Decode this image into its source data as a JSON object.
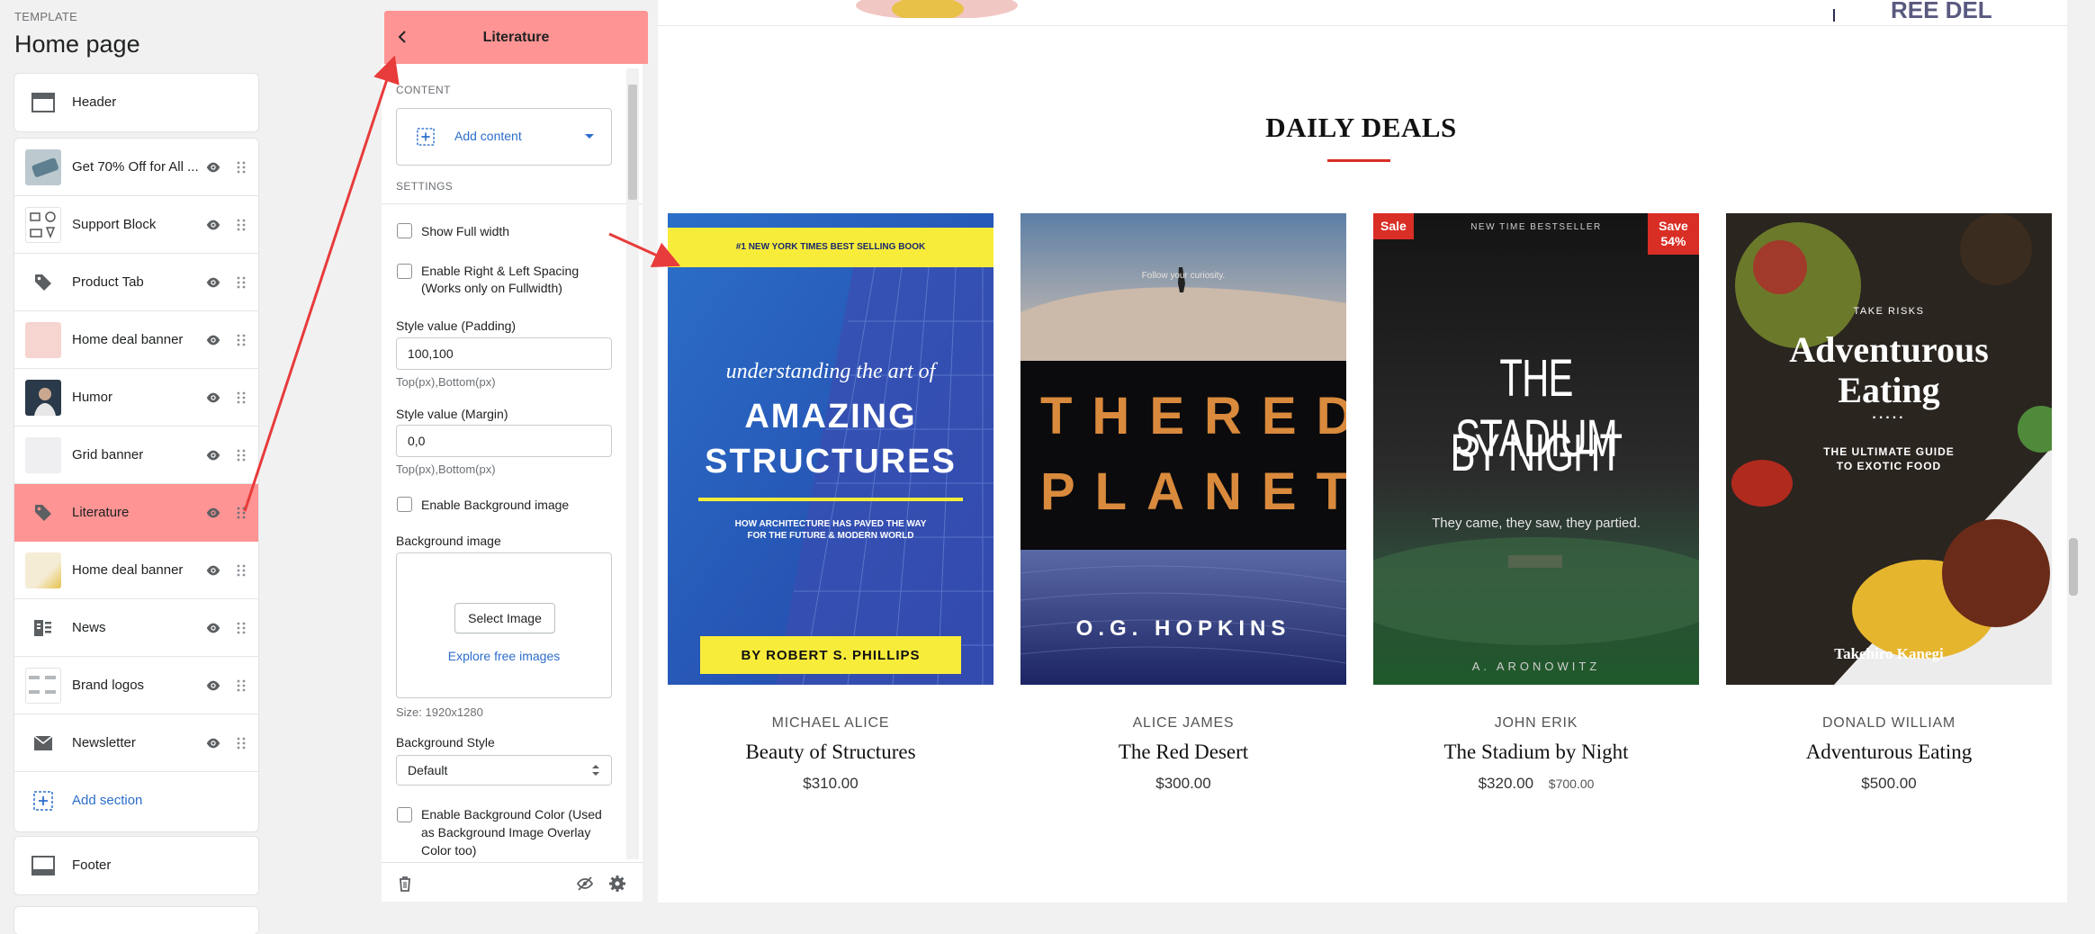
{
  "sidebar": {
    "template_label": "TEMPLATE",
    "page_title": "Home page",
    "header_label": "Header",
    "items": [
      {
        "label": "Get 70% Off for All ..."
      },
      {
        "label": "Support Block"
      },
      {
        "label": "Product Tab"
      },
      {
        "label": "Home deal banner"
      },
      {
        "label": "Humor"
      },
      {
        "label": "Grid banner"
      },
      {
        "label": "Literature"
      },
      {
        "label": "Home deal banner"
      },
      {
        "label": "News"
      },
      {
        "label": "Brand logos"
      },
      {
        "label": "Newsletter"
      }
    ],
    "add_section_label": "Add section",
    "footer_label": "Footer"
  },
  "editor": {
    "title": "Literature",
    "content_heading": "CONTENT",
    "add_content_label": "Add content",
    "settings_heading": "SETTINGS",
    "show_full_width": "Show Full width",
    "enable_spacing_line1": "Enable Right & Left Spacing",
    "enable_spacing_line2": "(Works only on Fullwidth)",
    "padding_label": "Style value (Padding)",
    "padding_value": "100,100",
    "padding_note": "Top(px),Bottom(px)",
    "margin_label": "Style value (Margin)",
    "margin_value": "0,0",
    "margin_note": "Top(px),Bottom(px)",
    "enable_bg_image": "Enable Background image",
    "bg_image_label": "Background image",
    "select_image_label": "Select Image",
    "explore_label": "Explore free images",
    "size_note": "Size: 1920x1280",
    "bg_style_label": "Background Style",
    "bg_style_value": "Default",
    "enable_bg_color_line1": "Enable Background Color (Used",
    "enable_bg_color_line2": "as Background Image Overlay",
    "enable_bg_color_line3": "Color too)"
  },
  "preview": {
    "section_title": "DAILY DEALS",
    "products": [
      {
        "author": "MICHAEL ALICE",
        "title": "Beauty of Structures",
        "price": "$310.00"
      },
      {
        "author": "ALICE JAMES",
        "title": "The Red Desert",
        "price": "$300.00"
      },
      {
        "author": "JOHN ERIK",
        "title": "The Stadium by Night",
        "price": "$320.00",
        "compare_price": "$700.00",
        "sale_badge": "Sale",
        "save_badge_line1": "Save",
        "save_badge_line2": "54%"
      },
      {
        "author": "DONALD WILLIAM",
        "title": "Adventurous Eating",
        "price": "$500.00"
      }
    ],
    "covers": {
      "c1_banner": "#1 NEW YORK TIMES BEST SELLING BOOK",
      "c1_line1": "understanding the art of",
      "c1_line2": "AMAZING",
      "c1_line3": "STRUCTURES",
      "c1_sub1": "HOW ARCHITECTURE HAS PAVED THE WAY",
      "c1_sub2": "FOR THE FUTURE & MODERN WORLD",
      "c1_author": "BY ROBERT S. PHILLIPS",
      "c2_tagline": "Follow your curiosity.",
      "c2_title1": "THERED",
      "c2_title2": "PLANET",
      "c2_author": "O.G. HOPKINS",
      "c3_top": "NEW TIME BESTSELLER",
      "c3_title1": "THE STADIUM",
      "c3_title2": "BY NIGHT",
      "c3_tagline": "They came, they saw, they partied.",
      "c3_author": "A. ARONOWITZ",
      "c4_top": "TAKE RISKS",
      "c4_title1": "Adventurous",
      "c4_title2": "Eating",
      "c4_dots": ".....",
      "c4_sub1": "THE ULTIMATE GUIDE",
      "c4_sub2": "TO EXOTIC FOOD",
      "c4_author": "Takehiro Kanegi"
    }
  },
  "colors": {
    "accent_red": "#d92e25",
    "highlight": "#ff9494",
    "link_blue": "#2c6ecb"
  }
}
